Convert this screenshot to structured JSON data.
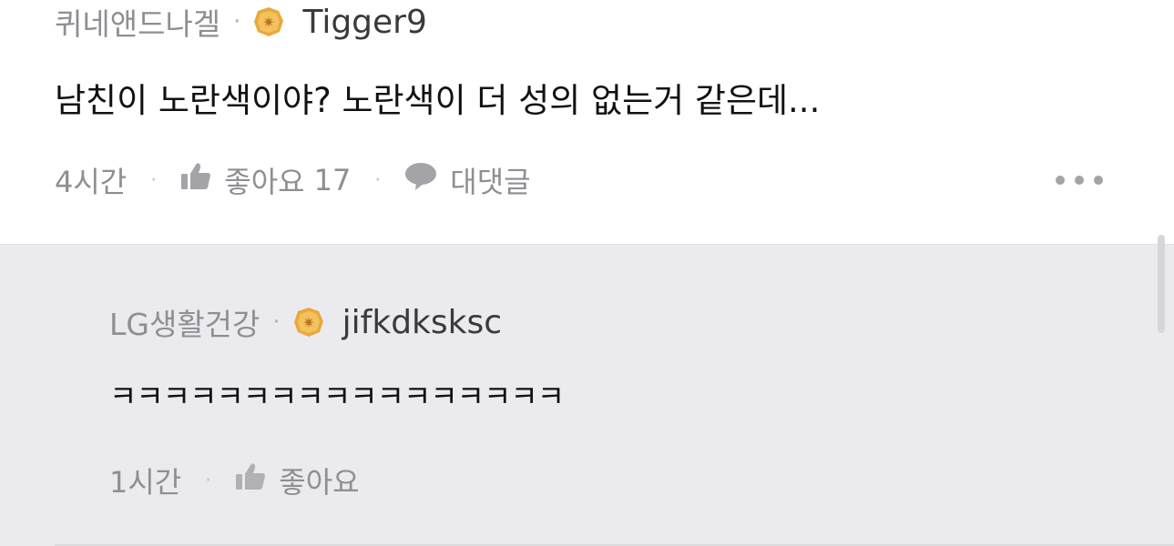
{
  "comment": {
    "company": "퀴네앤드나겔",
    "separator": "·",
    "nickname": "Tigger9",
    "text": "남친이 노란색이야? 노란색이 더 성의 없는거 같은데...",
    "time": "4시간",
    "like_label": "좋아요",
    "like_count": "17",
    "reply_label": "대댓글"
  },
  "reply": {
    "company": "LG생활건강",
    "separator": "·",
    "nickname": "jifkdksksс",
    "text": "ㅋㅋㅋㅋㅋㅋㅋㅋㅋㅋㅋㅋㅋㅋㅋㅋㅋ",
    "time": "1시간",
    "like_label": "좋아요"
  },
  "colors": {
    "badge": "#e9a93c",
    "reply_background": "#ebebef"
  },
  "icons": {
    "badge": "gold-badge-icon",
    "like": "thumbs-up-icon",
    "reply": "speech-bubble-icon",
    "more": "more-dots-icon"
  }
}
